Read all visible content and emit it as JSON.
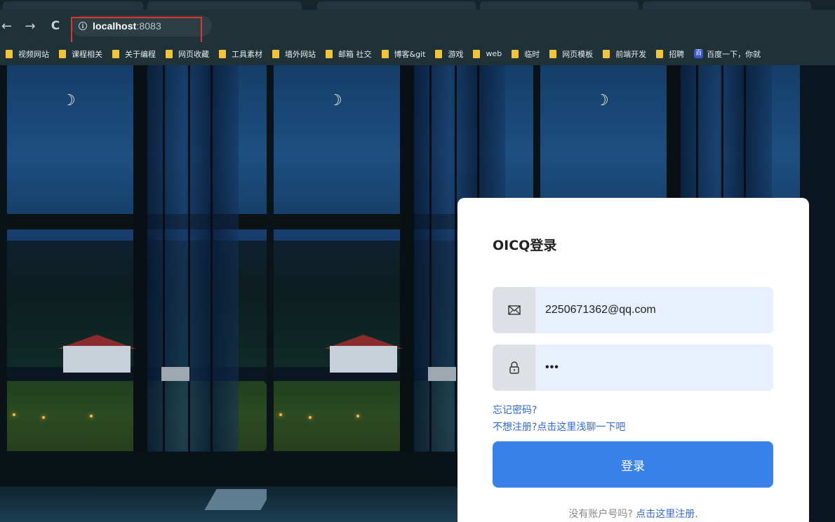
{
  "browser": {
    "nav": {
      "back": "←",
      "forward": "→",
      "reload": "C"
    },
    "address": {
      "info_icon": "ⓘ",
      "host": "localhost",
      "port": ":8083"
    },
    "bookmarks": [
      {
        "label": "视频网站",
        "icon": "folder-icon"
      },
      {
        "label": "课程相关",
        "icon": "folder-icon"
      },
      {
        "label": "关于编程",
        "icon": "folder-icon"
      },
      {
        "label": "网页收藏",
        "icon": "folder-icon"
      },
      {
        "label": "工具素材",
        "icon": "folder-icon"
      },
      {
        "label": "墙外网站",
        "icon": "folder-icon"
      },
      {
        "label": "邮箱 社交",
        "icon": "folder-icon"
      },
      {
        "label": "博客&git",
        "icon": "folder-icon"
      },
      {
        "label": "游戏",
        "icon": "folder-icon"
      },
      {
        "label": "web",
        "icon": "folder-icon"
      },
      {
        "label": "临时",
        "icon": "folder-icon"
      },
      {
        "label": "网页模板",
        "icon": "folder-icon"
      },
      {
        "label": "前端开发",
        "icon": "folder-icon"
      },
      {
        "label": "招聘",
        "icon": "folder-icon"
      },
      {
        "label": "百度一下，你就",
        "icon": "baidu-icon"
      }
    ]
  },
  "login": {
    "title": "OICQ登录",
    "email": {
      "value": "2250671362@qq.com",
      "icon": "mail-icon"
    },
    "password": {
      "value": "•••",
      "icon": "lock-icon"
    },
    "forgot_link": "忘记密码?",
    "chat_link": "不想注册?点击这里浅聊一下吧",
    "login_button": "登录",
    "register_prompt": "没有账户号吗? ",
    "register_link": "点击这里注册."
  },
  "colors": {
    "accent": "#3882e9",
    "link": "#2f6bd8",
    "highlight_box": "#e0342c"
  }
}
